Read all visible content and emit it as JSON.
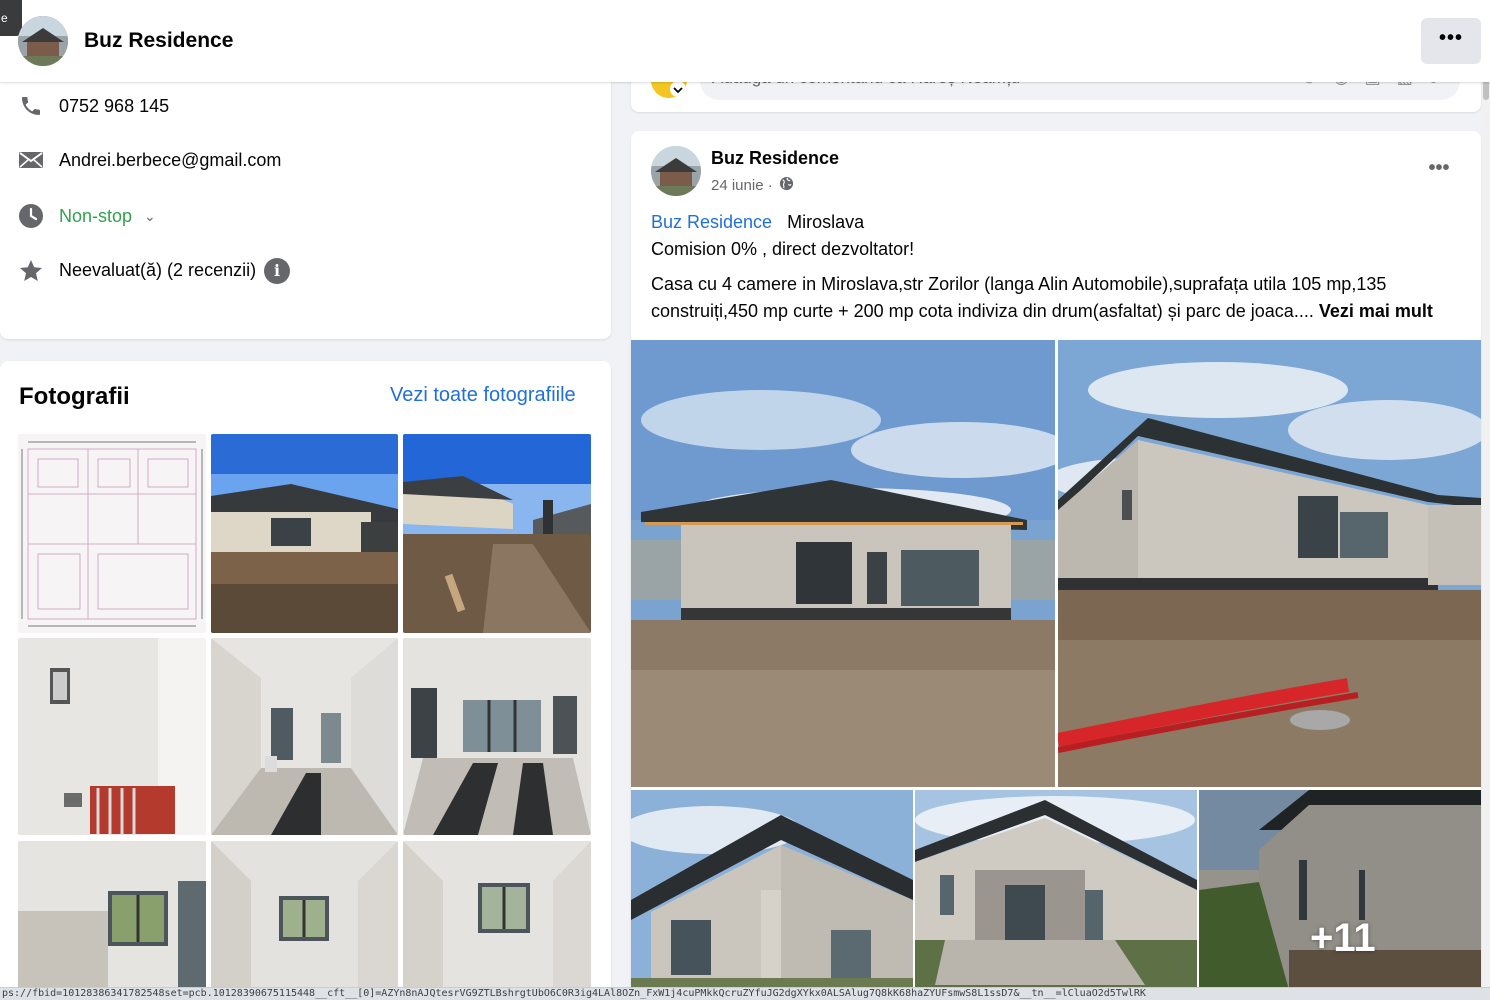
{
  "header": {
    "corner_tag": "e",
    "page_name": "Buz Residence",
    "more_label": "•••"
  },
  "intro": {
    "phone": "0752 968 145",
    "email": "Andrei.berbece@gmail.com",
    "hours": "Non-stop",
    "rating": "Neevaluat(ă) (2 recenzii)"
  },
  "photos": {
    "title": "Fotografii",
    "see_all": "Vezi toate fotografiile"
  },
  "comment": {
    "placeholder": "Adaugă un comentariu ca Rareș Neamțu"
  },
  "post": {
    "author": "Buz Residence",
    "date": "24 iunie ·",
    "more_label": "•••",
    "tag_page": "Buz Residence",
    "tag_location": "Miroslava",
    "line1": "Comision 0% , direct dezvoltator!",
    "line2": "Casa cu 4 camere in Miroslava,str Zorilor (langa Alin Automobile),suprafața utila 105 mp,135",
    "line3": "construiți,450 mp curte + 200 mp cota indiviza din drum(asfaltat) și parc de joaca....",
    "see_more": "Vezi mai mult",
    "extra_count": "+11"
  },
  "status_url": "ps://fbid=10128386341782548set=pcb.10128390675115448__cft__[0]=AZYn8nAJQtesrVG9ZTLBshrgtUbO6C0R3ig4LAl8OZn_FxW1j4cuPMkkQcruZYfuJG2dgXYkx0ALSAlug7Q8kK68haZYUFsmwS8L1ssD7&__tn__=lCluaO2d5TwlRK"
}
